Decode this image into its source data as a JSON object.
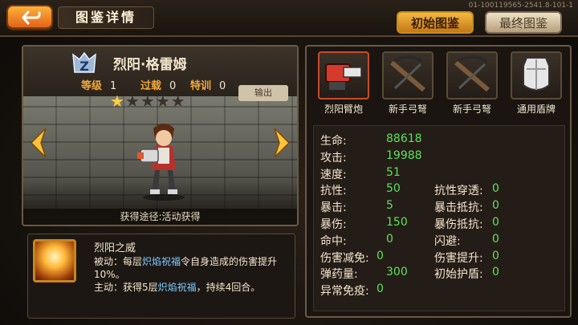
{
  "header": {
    "title": "图鉴详情",
    "version": "01-100119565-2541.8-101-1",
    "tabs": [
      "初始图鉴",
      "最终图鉴"
    ]
  },
  "hero": {
    "name": "烈阳·格雷姆",
    "rank": "Z",
    "level_label": "等级",
    "level": "1",
    "breakthrough_label": "过载",
    "breakthrough": "0",
    "training_label": "特训",
    "training": "0",
    "stars_total": 5,
    "stars_filled": 1,
    "export_label": "输出",
    "source": "获得途径:活动获得"
  },
  "skill": {
    "name": "烈阳之威",
    "line1_prefix": "被动：每层",
    "line1_hl": "炽焰祝福",
    "line1_suffix": "令自身造成的伤害提升10%。",
    "line2_prefix": "主动：获得5层",
    "line2_hl": "炽焰祝福",
    "line2_suffix": "，持续4回合。"
  },
  "equipment": [
    {
      "label": "烈阳臂炮",
      "icon": "arm-cannon-icon"
    },
    {
      "label": "新手弓弩",
      "icon": "crossbow-icon"
    },
    {
      "label": "新手弓弩",
      "icon": "crossbow-icon"
    },
    {
      "label": "通用盾牌",
      "icon": "shield-icon"
    }
  ],
  "stats_left": [
    {
      "name": "生命:",
      "value": "88618"
    },
    {
      "name": "攻击:",
      "value": "19988"
    },
    {
      "name": "速度:",
      "value": "51"
    },
    {
      "name": "抗性:",
      "value": "50"
    },
    {
      "name": "暴击:",
      "value": "5"
    },
    {
      "name": "暴伤:",
      "value": "150"
    },
    {
      "name": "命中:",
      "value": "0"
    },
    {
      "name": "伤害减免:",
      "value": "0"
    },
    {
      "name": "弹药量:",
      "value": "300"
    },
    {
      "name": "异常免疫:",
      "value": "0"
    }
  ],
  "stats_right": [
    {
      "name": "抗性穿透:",
      "value": "0"
    },
    {
      "name": "暴击抵抗:",
      "value": "0"
    },
    {
      "name": "暴伤抵抗:",
      "value": "0"
    },
    {
      "name": "闪避:",
      "value": "0"
    },
    {
      "name": "伤害提升:",
      "value": "0"
    },
    {
      "name": "初始护盾:",
      "value": "0"
    }
  ],
  "colors": {
    "accent": "#f2a93a",
    "stat_value": "#5fe05f",
    "highlight": "#7ecbff"
  }
}
